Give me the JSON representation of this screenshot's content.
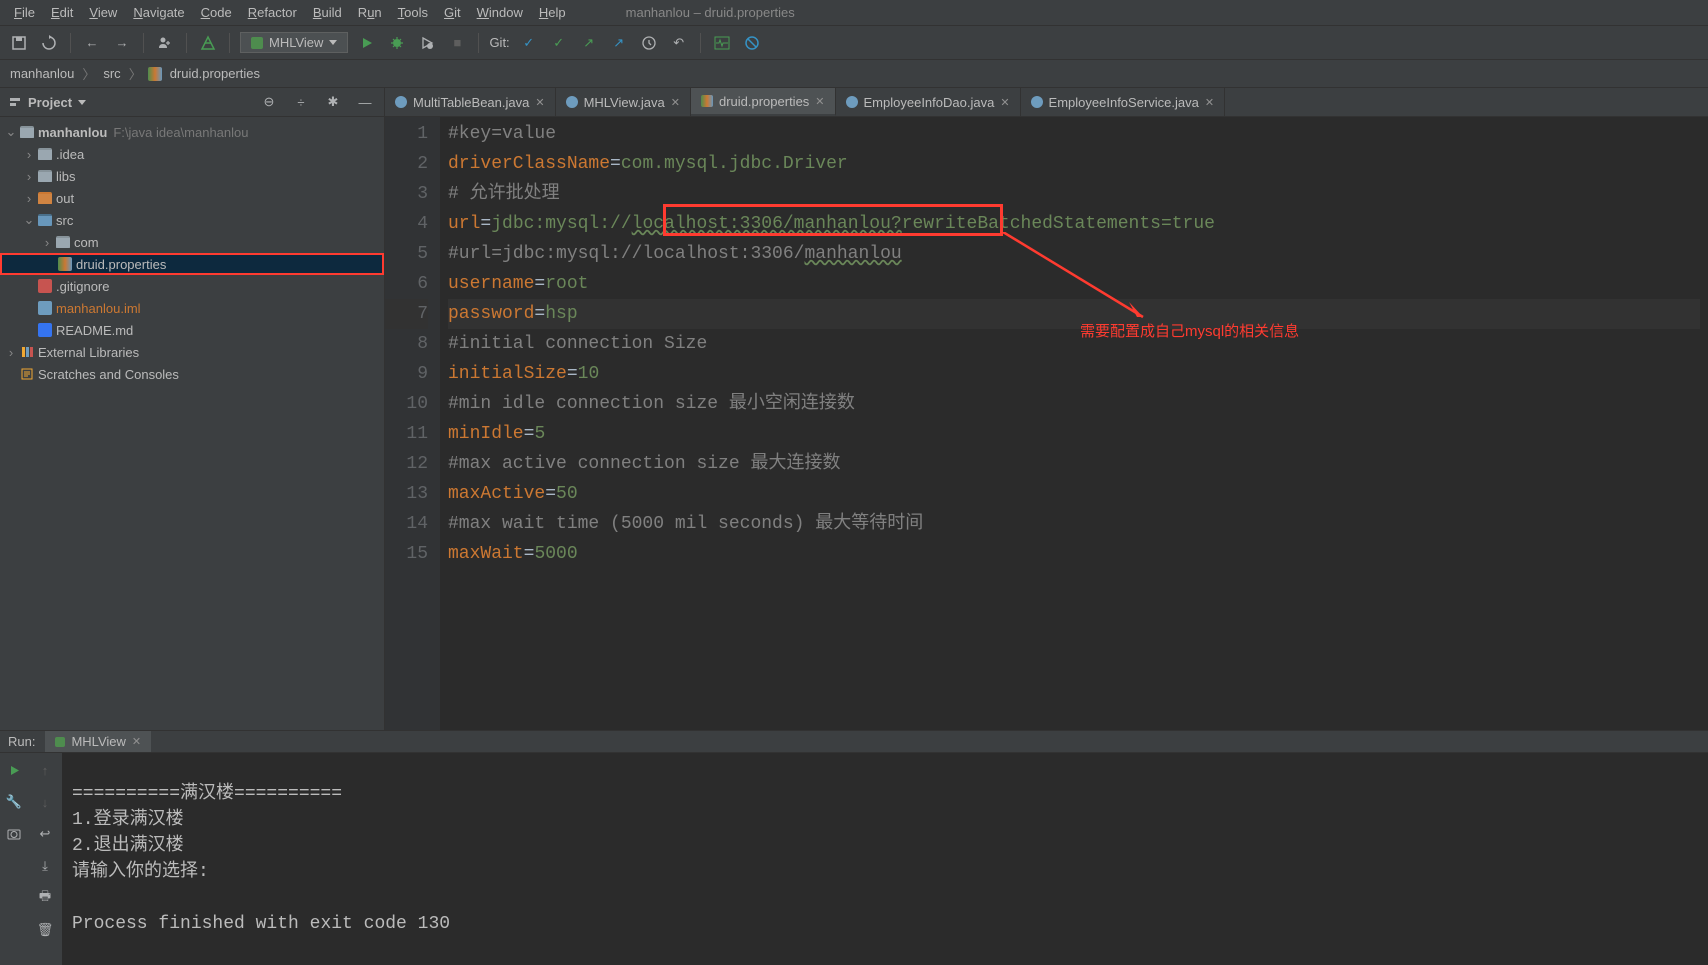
{
  "window": {
    "title": "manhanlou – druid.properties"
  },
  "menu": {
    "file": "File",
    "edit": "Edit",
    "view": "View",
    "navigate": "Navigate",
    "code": "Code",
    "refactor": "Refactor",
    "build": "Build",
    "run": "Run",
    "tools": "Tools",
    "git": "Git",
    "window": "Window",
    "help": "Help"
  },
  "toolbar": {
    "run_config": "MHLView",
    "git_label": "Git:"
  },
  "breadcrumb": {
    "p0": "manhanlou",
    "p1": "src",
    "p2": "druid.properties"
  },
  "sidebar": {
    "title": "Project",
    "root": {
      "label": "manhanlou",
      "hint": "F:\\java idea\\manhanlou"
    },
    "nodes": {
      "idea": ".idea",
      "libs": "libs",
      "out": "out",
      "src": "src",
      "com": "com",
      "druid": "druid.properties",
      "gitignore": ".gitignore",
      "iml": "manhanlou.iml",
      "readme": "README.md",
      "extlib": "External Libraries",
      "scratch": "Scratches and Consoles"
    }
  },
  "tabs": {
    "t0": "MultiTableBean.java",
    "t1": "MHLView.java",
    "t2": "druid.properties",
    "t3": "EmployeeInfoDao.java",
    "t4": "EmployeeInfoService.java"
  },
  "editor": {
    "lines": {
      "ln1": "1",
      "ln2": "2",
      "ln3": "3",
      "ln4": "4",
      "ln5": "5",
      "ln6": "6",
      "ln7": "7",
      "ln8": "8",
      "ln9": "9",
      "ln10": "10",
      "ln11": "11",
      "ln12": "12",
      "ln13": "13",
      "ln14": "14",
      "ln15": "15"
    },
    "l1": "#key=value",
    "l2_k": "driverClassName",
    "l2_v": "com.mysql.jdbc.Driver",
    "l3": "# 允许批处理",
    "l4_k": "url",
    "l4_v1": "jdbc:mysql://",
    "l4_v2": "localhost:3306/manhanlou?",
    "l4_v3": "rewriteBatchedStatements=true",
    "l5": "#url=jdbc:mysql://localhost:3306/",
    "l5b": "manhanlou",
    "l6_k": "username",
    "l6_v": "root",
    "l7_k": "password",
    "l7_v": "hsp",
    "l8": "#initial connection Size",
    "l9_k": "initialSize",
    "l9_v": "10",
    "l10": "#min idle connection size 最小空闲连接数",
    "l11_k": "minIdle",
    "l11_v": "5",
    "l12": "#max active connection size 最大连接数",
    "l13_k": "maxActive",
    "l13_v": "50",
    "l14": "#max wait time (5000 mil seconds) 最大等待时间",
    "l15_k": "maxWait",
    "l15_v": "5000"
  },
  "annotation": {
    "text": "需要配置成自己mysql的相关信息"
  },
  "run_panel": {
    "label": "Run:",
    "tab": "MHLView",
    "out1": "==========满汉楼==========",
    "out2": "1.登录满汉楼",
    "out3": "2.退出满汉楼",
    "out4": "请输入你的选择:",
    "out5": "",
    "out6": "Process finished with exit code 130"
  }
}
